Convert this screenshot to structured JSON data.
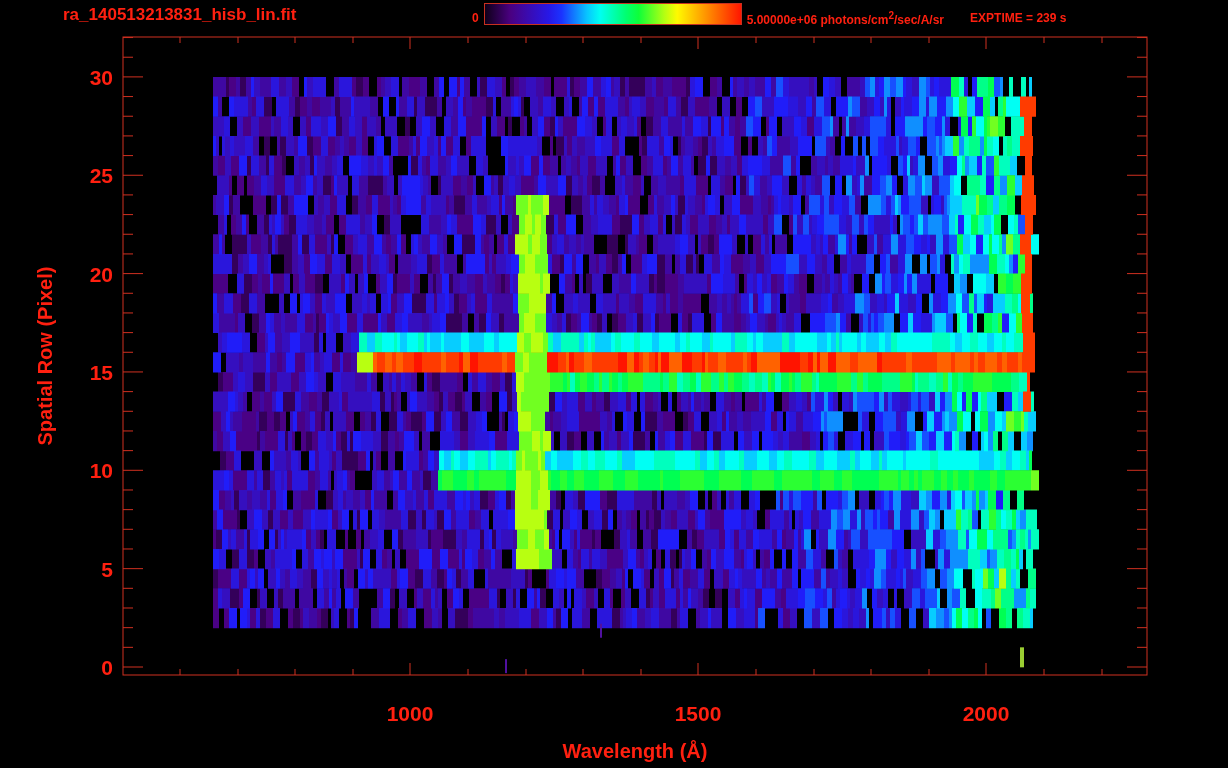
{
  "title": "ra_140513213831_hisb_lin.fit",
  "colorbar": {
    "min_label": "0",
    "max_label": "5.00000e+06 photons/cm$^{2}$/sec/A/sr"
  },
  "exposure": "EXPTIME = 239 s",
  "plot": {
    "xlabel": "Wavelength (Å)",
    "ylabel": "Spatial Row (Pixel)",
    "xtick_labels": [
      "1000",
      "1500",
      "2000"
    ],
    "ytick_labels": [
      "30",
      "25",
      "20",
      "15",
      "10",
      "5",
      "0"
    ]
  }
}
